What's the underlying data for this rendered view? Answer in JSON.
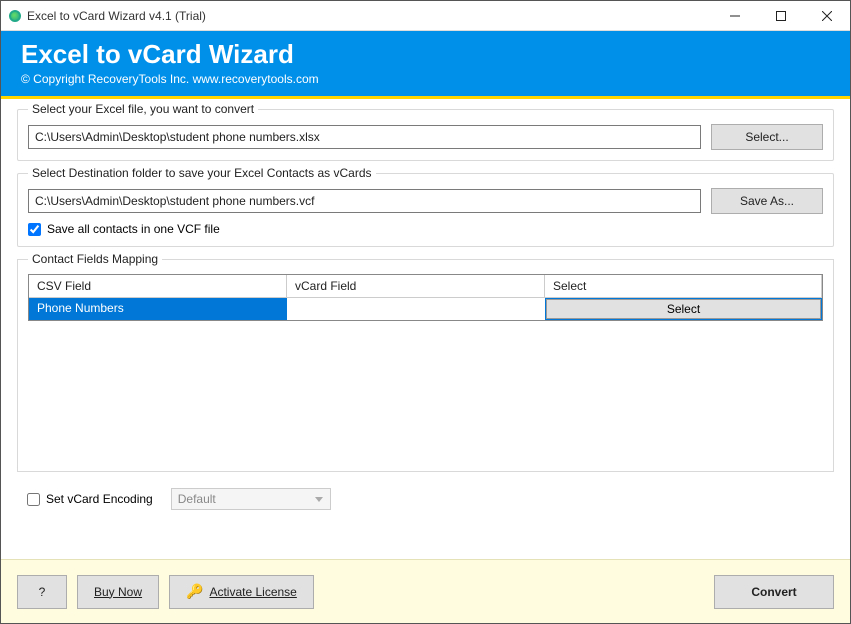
{
  "window": {
    "title": "Excel to vCard Wizard v4.1 (Trial)"
  },
  "banner": {
    "heading": "Excel to vCard Wizard",
    "copyright": "© Copyright RecoveryTools Inc. www.recoverytools.com"
  },
  "source": {
    "group_label": "Select your Excel file, you want to convert",
    "path": "C:\\Users\\Admin\\Desktop\\student phone numbers.xlsx",
    "button": "Select..."
  },
  "dest": {
    "group_label": "Select Destination folder to save your Excel Contacts as vCards",
    "path": "C:\\Users\\Admin\\Desktop\\student phone numbers.vcf",
    "button": "Save As...",
    "checkbox_label": "Save all contacts in one VCF file",
    "checkbox_checked": true
  },
  "mapping": {
    "group_label": "Contact Fields Mapping",
    "headers": {
      "csv": "CSV Field",
      "vcard": "vCard Field",
      "select": "Select"
    },
    "rows": [
      {
        "csv": "Phone Numbers",
        "vcard": "",
        "select_label": "Select"
      }
    ]
  },
  "encoding": {
    "checkbox_label": "Set vCard Encoding",
    "value": "Default"
  },
  "footer": {
    "help": "?",
    "buy": "Buy Now",
    "activate": "Activate License",
    "convert": "Convert"
  }
}
